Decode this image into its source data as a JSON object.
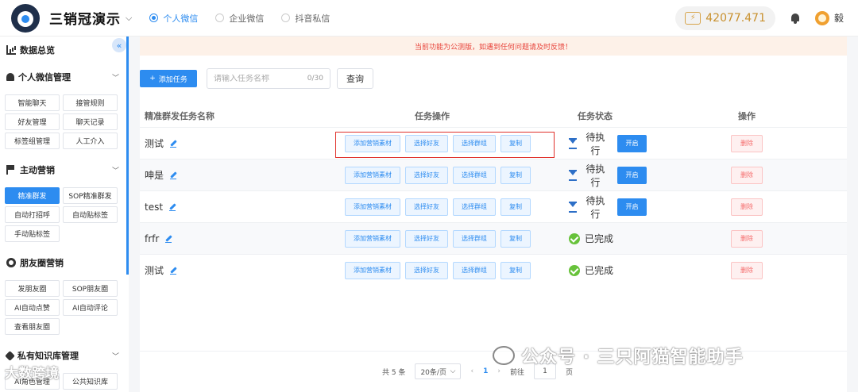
{
  "header": {
    "brand": "三销冠演示",
    "platforms": [
      {
        "label": "个人微信",
        "active": true
      },
      {
        "label": "企业微信",
        "active": false
      },
      {
        "label": "抖音私信",
        "active": false
      }
    ],
    "credits": "42077.471",
    "username": "毅"
  },
  "sidebar": {
    "sections": [
      {
        "title": "数据总览",
        "icon": "bar-chart-icon",
        "items": []
      },
      {
        "title": "个人微信管理",
        "icon": "bell-icon",
        "items": [
          "智能聊天",
          "接管规则",
          "好友管理",
          "聊天记录",
          "标签组管理",
          "人工介入"
        ]
      },
      {
        "title": "主动营销",
        "icon": "flag-icon",
        "items": [
          "精准群发",
          "SOP精准群发",
          "自动打招呼",
          "自动贴标签",
          "手动贴标签"
        ]
      },
      {
        "title": "朋友圈营销",
        "icon": "aperture-icon",
        "items": [
          "发朋友圈",
          "SOP朋友圈",
          "AI自动点赞",
          "AI自动评论",
          "查看朋友圈"
        ]
      },
      {
        "title": "私有知识库管理",
        "icon": "tag-icon",
        "items": [
          "AI角色管理",
          "公共知识库"
        ]
      }
    ],
    "active_item": "精准群发",
    "watermark": "大数跨境"
  },
  "notice": "当前功能为公测版，如遇到任何问题请及时反馈！",
  "toolbar": {
    "add_label": "添加任务",
    "search_placeholder": "请输入任务名称",
    "search_count": "0/30",
    "query_label": "查询"
  },
  "table": {
    "headers": {
      "name": "精准群发任务名称",
      "ops": "任务操作",
      "status": "任务状态",
      "action": "操作"
    },
    "op_labels": [
      "添加营销素材",
      "选择好友",
      "选择群组",
      "复制"
    ],
    "start_label": "开启",
    "delete_label": "删除",
    "rows": [
      {
        "name": "测试",
        "status": "待执行",
        "pending": true
      },
      {
        "name": "呻是",
        "status": "待执行",
        "pending": true
      },
      {
        "name": "test",
        "status": "待执行",
        "pending": true
      },
      {
        "name": "frfr",
        "status": "已完成",
        "pending": false
      },
      {
        "name": "测试",
        "status": "已完成",
        "pending": false
      }
    ]
  },
  "pagination": {
    "total": "共 5 条",
    "page_size": "20条/页",
    "current_page": "1",
    "goto_label": "前往",
    "goto_value": "1",
    "page_suffix": "页"
  },
  "watermark": "公众号 · 三只阿猫智能助手"
}
